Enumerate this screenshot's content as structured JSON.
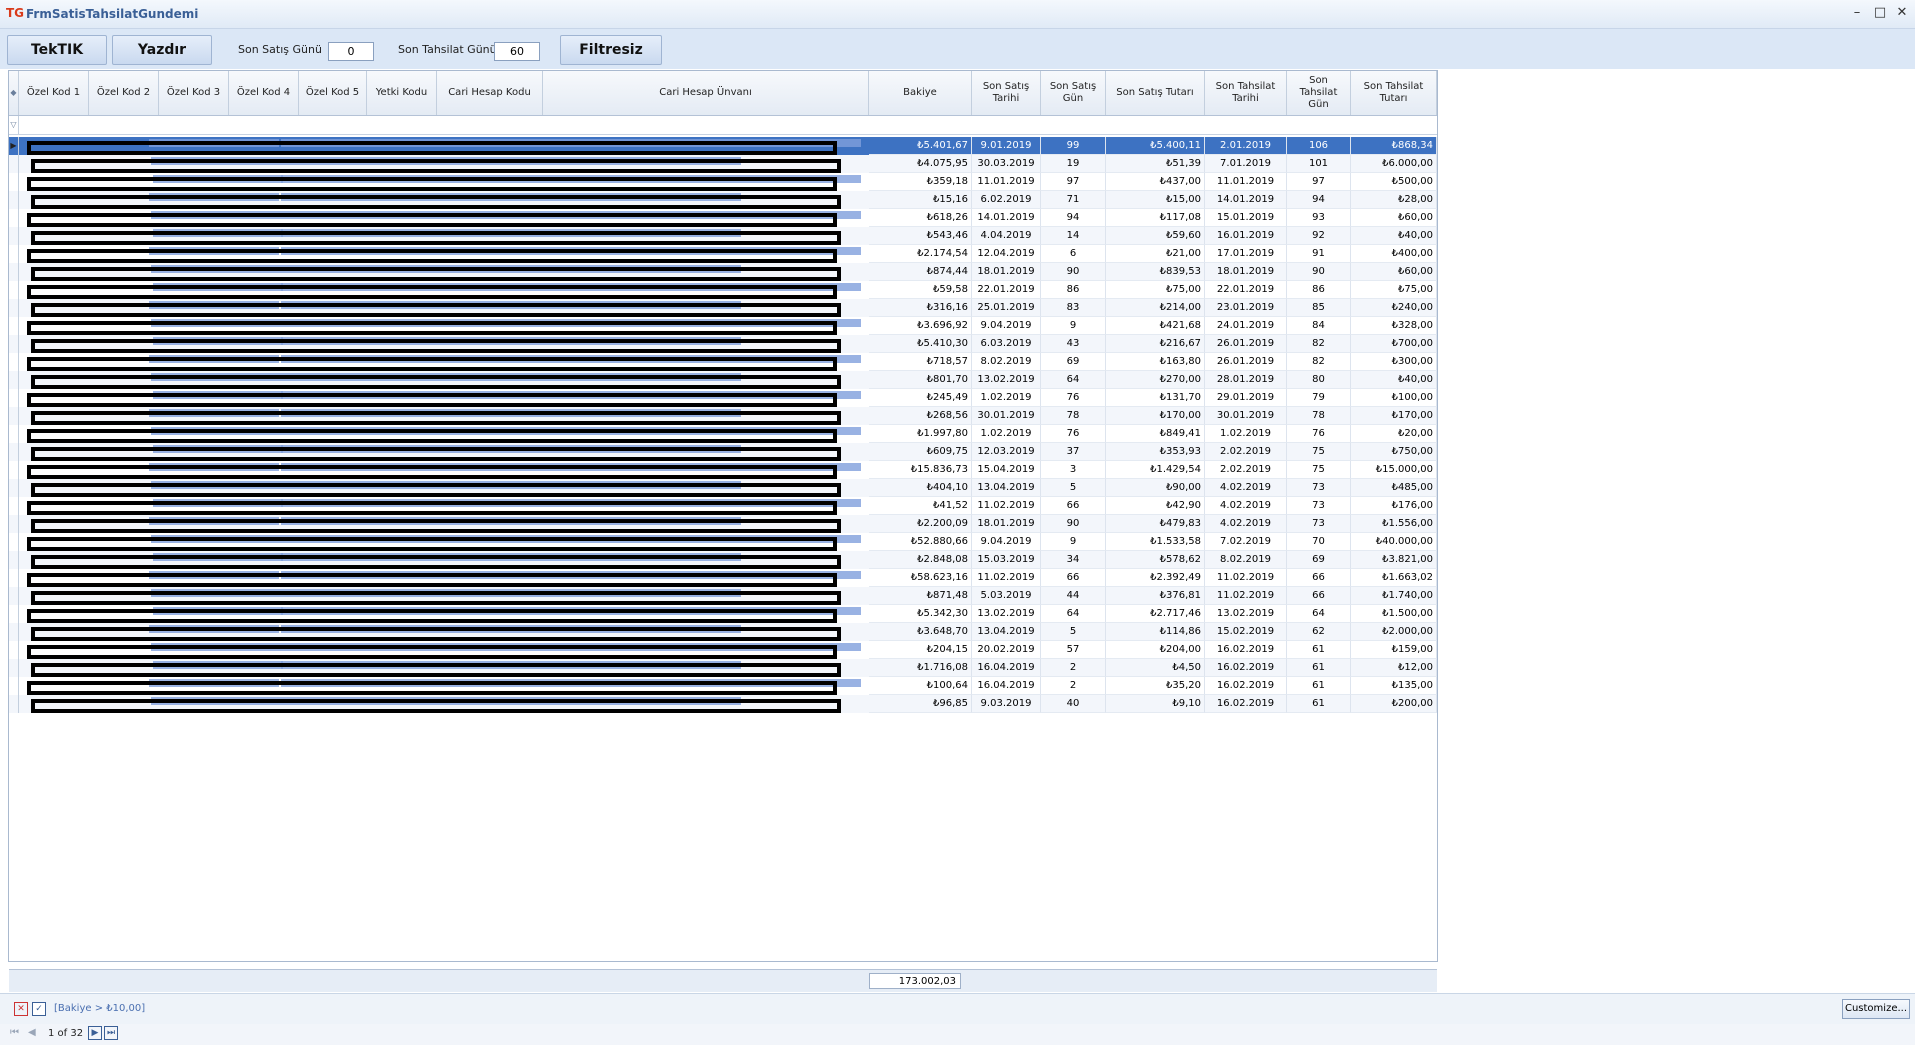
{
  "window": {
    "title": "FrmSatisTahsilatGundemi",
    "logo": "TG"
  },
  "toolbar": {
    "tektik_label": "TekTIK",
    "yazdir_label": "Yazdır",
    "son_satis_label": "Son Satış Günü",
    "son_satis_value": "0",
    "son_tahsilat_label": "Son Tahsilat Günü",
    "son_tahsilat_value": "60",
    "filtresiz_label": "Filtresiz"
  },
  "columns": [
    "Özel Kod 1",
    "Özel Kod 2",
    "Özel Kod 3",
    "Özel Kod 4",
    "Özel Kod 5",
    "Yetki Kodu",
    "Cari Hesap Kodu",
    "Cari Hesap Ünvanı",
    "Bakiye",
    "Son Satış Tarihi",
    "Son Satış Gün",
    "Son Satış Tutarı",
    "Son Tahsilat Tarihi",
    "Son Tahsilat Gün",
    "Son Tahsilat Tutarı"
  ],
  "rows": [
    [
      "₺5.401,67",
      "9.01.2019",
      "99",
      "₺5.400,11",
      "2.01.2019",
      "106",
      "₺868,34"
    ],
    [
      "₺4.075,95",
      "30.03.2019",
      "19",
      "₺51,39",
      "7.01.2019",
      "101",
      "₺6.000,00"
    ],
    [
      "₺359,18",
      "11.01.2019",
      "97",
      "₺437,00",
      "11.01.2019",
      "97",
      "₺500,00"
    ],
    [
      "₺15,16",
      "6.02.2019",
      "71",
      "₺15,00",
      "14.01.2019",
      "94",
      "₺28,00"
    ],
    [
      "₺618,26",
      "14.01.2019",
      "94",
      "₺117,08",
      "15.01.2019",
      "93",
      "₺60,00"
    ],
    [
      "₺543,46",
      "4.04.2019",
      "14",
      "₺59,60",
      "16.01.2019",
      "92",
      "₺40,00"
    ],
    [
      "₺2.174,54",
      "12.04.2019",
      "6",
      "₺21,00",
      "17.01.2019",
      "91",
      "₺400,00"
    ],
    [
      "₺874,44",
      "18.01.2019",
      "90",
      "₺839,53",
      "18.01.2019",
      "90",
      "₺60,00"
    ],
    [
      "₺59,58",
      "22.01.2019",
      "86",
      "₺75,00",
      "22.01.2019",
      "86",
      "₺75,00"
    ],
    [
      "₺316,16",
      "25.01.2019",
      "83",
      "₺214,00",
      "23.01.2019",
      "85",
      "₺240,00"
    ],
    [
      "₺3.696,92",
      "9.04.2019",
      "9",
      "₺421,68",
      "24.01.2019",
      "84",
      "₺328,00"
    ],
    [
      "₺5.410,30",
      "6.03.2019",
      "43",
      "₺216,67",
      "26.01.2019",
      "82",
      "₺700,00"
    ],
    [
      "₺718,57",
      "8.02.2019",
      "69",
      "₺163,80",
      "26.01.2019",
      "82",
      "₺300,00"
    ],
    [
      "₺801,70",
      "13.02.2019",
      "64",
      "₺270,00",
      "28.01.2019",
      "80",
      "₺40,00"
    ],
    [
      "₺245,49",
      "1.02.2019",
      "76",
      "₺131,70",
      "29.01.2019",
      "79",
      "₺100,00"
    ],
    [
      "₺268,56",
      "30.01.2019",
      "78",
      "₺170,00",
      "30.01.2019",
      "78",
      "₺170,00"
    ],
    [
      "₺1.997,80",
      "1.02.2019",
      "76",
      "₺849,41",
      "1.02.2019",
      "76",
      "₺20,00"
    ],
    [
      "₺609,75",
      "12.03.2019",
      "37",
      "₺353,93",
      "2.02.2019",
      "75",
      "₺750,00"
    ],
    [
      "₺15.836,73",
      "15.04.2019",
      "3",
      "₺1.429,54",
      "2.02.2019",
      "75",
      "₺15.000,00"
    ],
    [
      "₺404,10",
      "13.04.2019",
      "5",
      "₺90,00",
      "4.02.2019",
      "73",
      "₺485,00"
    ],
    [
      "₺41,52",
      "11.02.2019",
      "66",
      "₺42,90",
      "4.02.2019",
      "73",
      "₺176,00"
    ],
    [
      "₺2.200,09",
      "18.01.2019",
      "90",
      "₺479,83",
      "4.02.2019",
      "73",
      "₺1.556,00"
    ],
    [
      "₺52.880,66",
      "9.04.2019",
      "9",
      "₺1.533,58",
      "7.02.2019",
      "70",
      "₺40.000,00"
    ],
    [
      "₺2.848,08",
      "15.03.2019",
      "34",
      "₺578,62",
      "8.02.2019",
      "69",
      "₺3.821,00"
    ],
    [
      "₺58.623,16",
      "11.02.2019",
      "66",
      "₺2.392,49",
      "11.02.2019",
      "66",
      "₺1.663,02"
    ],
    [
      "₺871,48",
      "5.03.2019",
      "44",
      "₺376,81",
      "11.02.2019",
      "66",
      "₺1.740,00"
    ],
    [
      "₺5.342,30",
      "13.02.2019",
      "64",
      "₺2.717,46",
      "13.02.2019",
      "64",
      "₺1.500,00"
    ],
    [
      "₺3.648,70",
      "13.04.2019",
      "5",
      "₺114,86",
      "15.02.2019",
      "62",
      "₺2.000,00"
    ],
    [
      "₺204,15",
      "20.02.2019",
      "57",
      "₺204,00",
      "16.02.2019",
      "61",
      "₺159,00"
    ],
    [
      "₺1.716,08",
      "16.04.2019",
      "2",
      "₺4,50",
      "16.02.2019",
      "61",
      "₺12,00"
    ],
    [
      "₺100,64",
      "16.04.2019",
      "2",
      "₺35,20",
      "16.02.2019",
      "61",
      "₺135,00"
    ],
    [
      "₺96,85",
      "9.03.2019",
      "40",
      "₺9,10",
      "16.02.2019",
      "61",
      "₺200,00"
    ]
  ],
  "summary": {
    "total_bakiye": "173.002,03"
  },
  "filter": {
    "text": "[Bakiye > ₺10,00]",
    "customize_label": "Customize..."
  },
  "pager": {
    "text": "1 of 32"
  }
}
